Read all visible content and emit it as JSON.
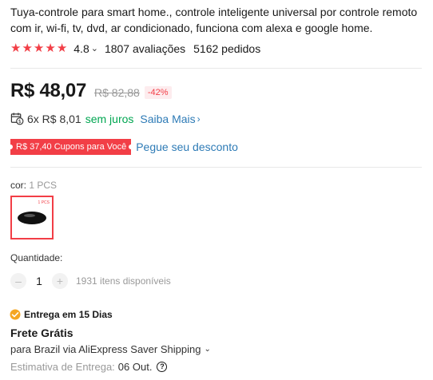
{
  "product": {
    "title": "Tuya-controle para smart home., controle inteligente universal por controle remoto com ir, wi-fi, tv, dvd, ar condicionado, funciona com alexa e google home."
  },
  "rating": {
    "stars": 5,
    "value": "4.8",
    "reviews": "1807 avaliações",
    "orders": "5162 pedidos"
  },
  "price": {
    "current": "R$ 48,07",
    "original": "R$ 82,88",
    "discount": "-42%"
  },
  "installments": {
    "text": "6x R$ 8,01",
    "interest_free": "sem juros",
    "more_link": "Saiba Mais"
  },
  "coupon": {
    "badge": "R$ 37,40 Cupons para Você",
    "link": "Pegue seu desconto"
  },
  "variant": {
    "label": "cor:",
    "selected": "1 PCS",
    "swatch_tag": "1 PCS"
  },
  "quantity": {
    "label": "Quantidade:",
    "minus": "–",
    "value": "1",
    "plus": "+",
    "available": "1931 itens disponíveis"
  },
  "shipping": {
    "delivery_badge": "Entrega em 15 Dias",
    "free_shipping": "Frete Grátis",
    "method": "para Brazil via AliExpress Saver Shipping",
    "estimate_label": "Estimativa de Entrega:",
    "estimate_date": "06 Out.",
    "help": "?"
  },
  "colors": {
    "accent_red": "#f23e46",
    "link_blue": "#2e7bb6",
    "green": "#00a651",
    "delivery_orange": "#f5a623"
  },
  "icons": {
    "star": "star-icon",
    "chevron_down": "chevron-down-icon",
    "calendar": "calendar-money-icon",
    "chevron_right": "chevron-right-icon",
    "truck": "delivery-truck-icon",
    "help": "help-circle-icon"
  }
}
